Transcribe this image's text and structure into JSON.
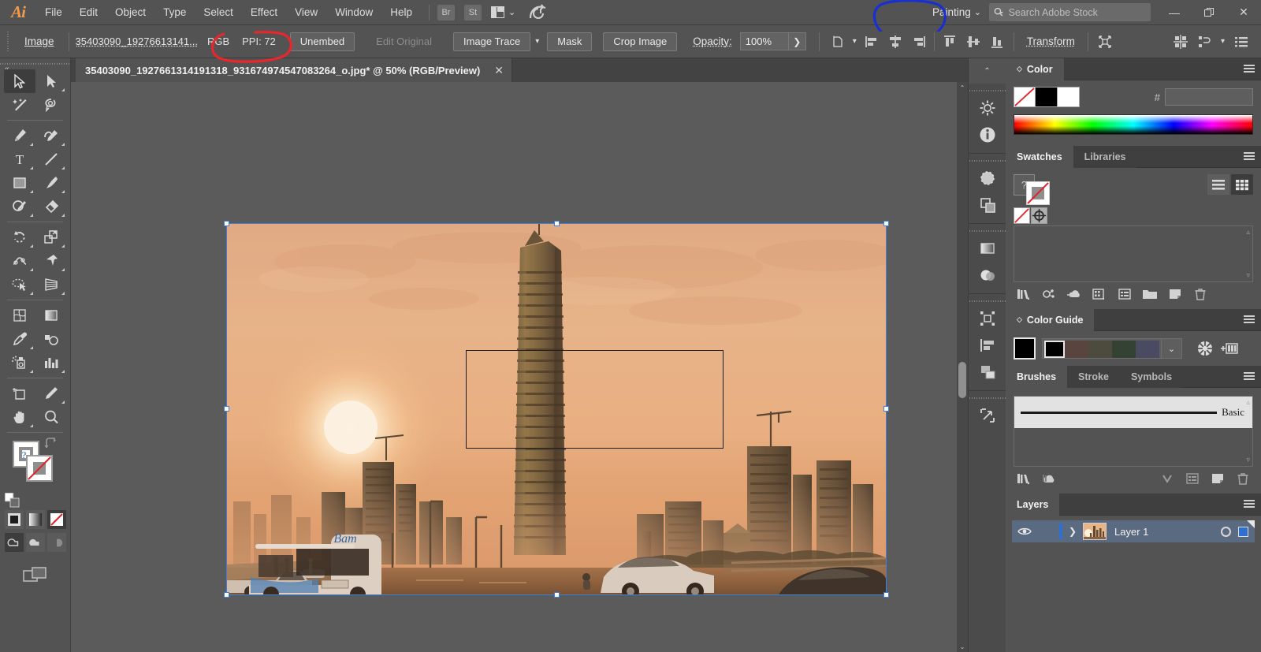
{
  "app": {
    "name": "Adobe Illustrator",
    "logo": "Ai"
  },
  "menubar": {
    "items": [
      "File",
      "Edit",
      "Object",
      "Type",
      "Select",
      "Effect",
      "View",
      "Window",
      "Help"
    ],
    "bridge_label": "Br",
    "stock_label": "St",
    "arrange_icon": "arrange-documents-icon",
    "workspace": {
      "label": "Painting",
      "chevron": "⌄"
    },
    "search": {
      "placeholder": "Search Adobe Stock",
      "value": "",
      "icon": "search-icon"
    },
    "window_controls": {
      "minimize": "—",
      "restore": "❐",
      "close": "✕"
    }
  },
  "controlbar": {
    "object_label": "Image",
    "file_name": "35403090_19276613141...",
    "color_mode": "RGB",
    "ppi": "PPI: 72",
    "unembed_label": "Unembed",
    "edit_original_label": "Edit Original",
    "image_trace_label": "Image Trace",
    "mask_label": "Mask",
    "crop_image_label": "Crop Image",
    "opacity_label": "Opacity:",
    "opacity_value": "100%",
    "transform_label": "Transform",
    "icons": [
      "document-setup-icon",
      "align-left-icon",
      "align-horizontal-center-icon",
      "align-right-icon",
      "align-top-icon",
      "align-vertical-center-icon",
      "align-bottom-icon",
      "isolate-selection-icon",
      "distribute-spacing-icon",
      "arrange-icon",
      "list-view-icon"
    ]
  },
  "document": {
    "tab_title": "35403090_1927661314191318_931674974547083264_o.jpg* @ 50% (RGB/Preview)",
    "close_label": "✕",
    "zoom_level": "50%",
    "color_mode": "RGB/Preview",
    "file_name": "35403090_1927661314191318_931674974547083264_o.jpg",
    "modified": true
  },
  "toolbar": {
    "tools": [
      {
        "name": "selection-tool",
        "active": true,
        "more": false
      },
      {
        "name": "direct-selection-tool",
        "active": false,
        "more": true
      },
      {
        "name": "magic-wand-tool",
        "active": false,
        "more": false
      },
      {
        "name": "lasso-tool",
        "active": false,
        "more": false
      },
      {
        "name": "pen-tool",
        "active": false,
        "more": true
      },
      {
        "name": "curvature-tool",
        "active": false,
        "more": true
      },
      {
        "name": "type-tool",
        "active": false,
        "more": true
      },
      {
        "name": "line-segment-tool",
        "active": false,
        "more": true
      },
      {
        "name": "rectangle-tool",
        "active": false,
        "more": true
      },
      {
        "name": "paintbrush-tool",
        "active": false,
        "more": true
      },
      {
        "name": "shaper-tool",
        "active": false,
        "more": true
      },
      {
        "name": "eraser-tool",
        "active": false,
        "more": true
      },
      {
        "name": "rotate-tool",
        "active": false,
        "more": true
      },
      {
        "name": "scale-tool",
        "active": false,
        "more": true
      },
      {
        "name": "width-tool",
        "active": false,
        "more": true
      },
      {
        "name": "free-transform-tool",
        "active": false,
        "more": true
      },
      {
        "name": "shape-builder-tool",
        "active": false,
        "more": true
      },
      {
        "name": "perspective-grid-tool",
        "active": false,
        "more": true
      },
      {
        "name": "mesh-tool",
        "active": false,
        "more": false
      },
      {
        "name": "gradient-tool",
        "active": false,
        "more": false
      },
      {
        "name": "eyedropper-tool",
        "active": false,
        "more": true
      },
      {
        "name": "blend-tool",
        "active": false,
        "more": false
      },
      {
        "name": "symbol-sprayer-tool",
        "active": false,
        "more": true
      },
      {
        "name": "column-graph-tool",
        "active": false,
        "more": true
      },
      {
        "name": "artboard-tool",
        "active": false,
        "more": false
      },
      {
        "name": "slice-tool",
        "active": false,
        "more": true
      },
      {
        "name": "hand-tool",
        "active": false,
        "more": true
      },
      {
        "name": "zoom-tool",
        "active": false,
        "more": false
      }
    ],
    "fill_stroke": {
      "fill_name": "fill-swatch",
      "stroke_name": "stroke-swatch",
      "swap_name": "swap-fill-stroke-icon",
      "default_name": "default-fill-stroke-icon",
      "fill_value": "None",
      "stroke_value": "None"
    },
    "color_modes": [
      "color-swatch-button",
      "gradient-swatch-button",
      "none-swatch-button"
    ],
    "draw_modes": [
      "draw-normal-button",
      "draw-behind-button",
      "draw-inside-button"
    ],
    "screen_mode": "change-screen-mode-button"
  },
  "panels": {
    "color": {
      "title": "Color",
      "hash_symbol": "#",
      "hex_value": "",
      "fill_swatch": "none",
      "stroke_swatch": "black"
    },
    "swatches": {
      "tabs": [
        "Swatches",
        "Libraries"
      ],
      "active_tab": "Swatches",
      "help_glyph": "?",
      "items": [
        "none-swatch",
        "registration-swatch"
      ],
      "view_modes": [
        "list-view-icon",
        "grid-view-icon"
      ],
      "active_view": "grid-view-icon",
      "footer_icons": [
        "swatch-libraries-menu-icon",
        "color-themes-icon",
        "add-to-library-icon",
        "show-swatch-kinds-icon",
        "swatch-options-icon",
        "new-color-group-icon",
        "new-swatch-icon",
        "delete-swatch-icon"
      ]
    },
    "color_guide": {
      "title": "Color Guide",
      "base_color": "#000000",
      "harmony_colors": [
        "#000000",
        "#5a4440",
        "#4d4b3e",
        "#344233",
        "#4a4b63"
      ],
      "dropdown": "⌄",
      "footer_icons": [
        "edit-colors-icon",
        "save-color-group-icon"
      ]
    },
    "brushes": {
      "tabs": [
        "Brushes",
        "Stroke",
        "Symbols"
      ],
      "active_tab": "Brushes",
      "items": [
        {
          "name": "Basic",
          "type": "calligraphic"
        }
      ],
      "footer_icons": [
        "brush-libraries-menu-icon",
        "libraries-panel-icon",
        "remove-brush-stroke-icon",
        "brush-options-icon",
        "new-brush-icon",
        "delete-brush-icon"
      ]
    },
    "layers": {
      "title": "Layers",
      "rows": [
        {
          "name": "Layer 1",
          "visible": true,
          "locked": false,
          "selected": true,
          "expandable": true
        }
      ]
    }
  },
  "icon_dock": {
    "collapse": "⌃",
    "groups": [
      [
        "properties-icon",
        "document-info-icon"
      ],
      [
        "transparency-icon",
        "pathfinder-icon"
      ],
      [
        "gradient-icon",
        "appearance-icon"
      ],
      [
        "symbols-icon",
        "align-icon",
        "transform-panel-icon"
      ],
      [
        "asset-export-icon"
      ]
    ]
  },
  "canvas": {
    "background": "#5b5b5b",
    "selection_color": "#3f7fd8",
    "artboard_border": "#1d1d1d",
    "scroll": {
      "up": "⌃",
      "down": "⌄"
    }
  },
  "annotations": [
    {
      "name": "red-circle-annotation",
      "color": "#e8272c",
      "target": "RGB PPI: 72",
      "shape": "hand-drawn-ellipse"
    },
    {
      "name": "blue-circle-annotation",
      "color": "#1a2fd0",
      "target": "Painting workspace switcher",
      "shape": "hand-drawn-ellipse"
    }
  ]
}
